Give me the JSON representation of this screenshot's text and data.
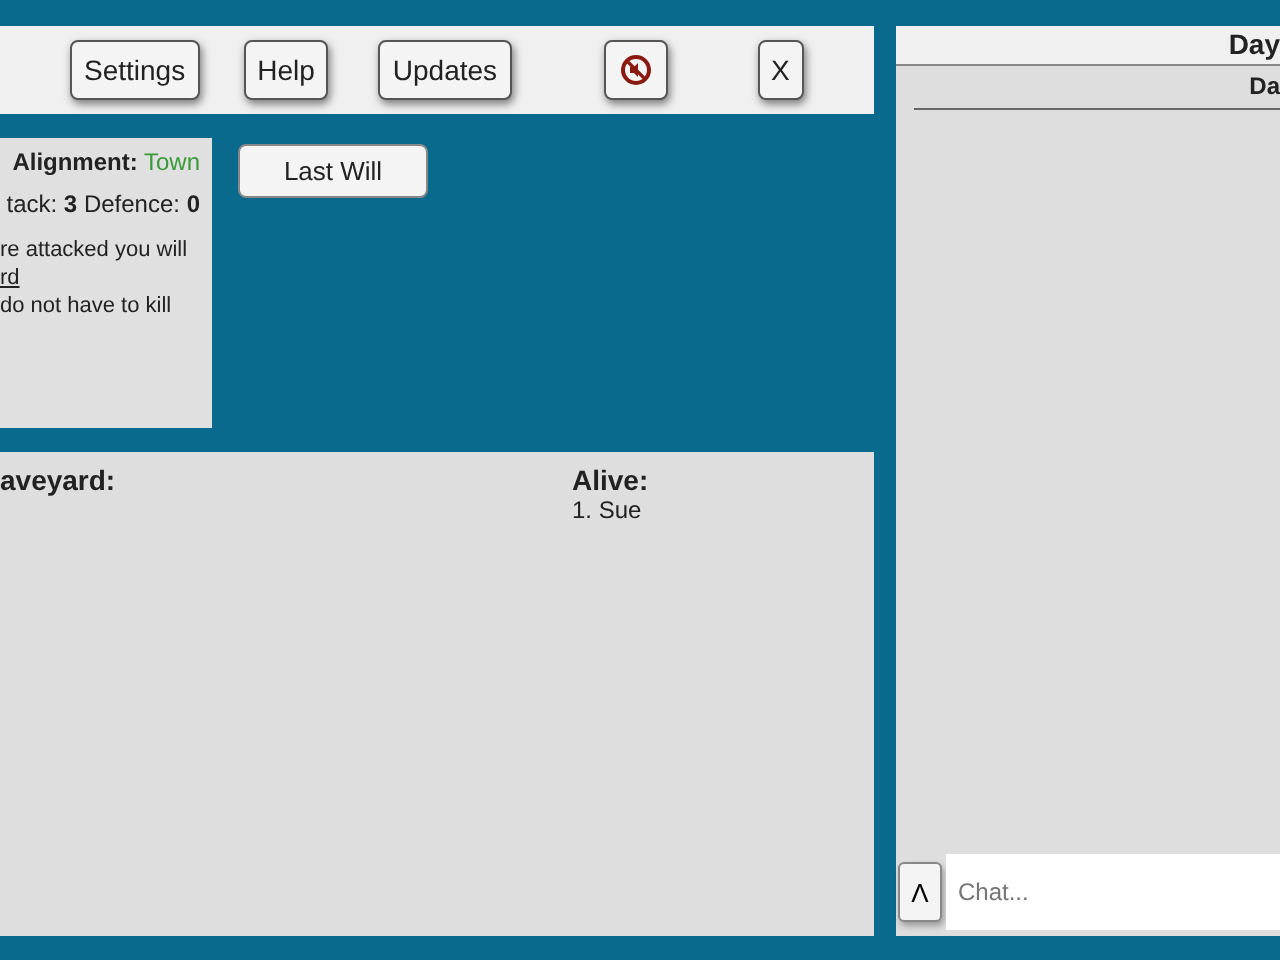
{
  "toolbar": {
    "buttons": [
      {
        "kind": "text",
        "label": "Settings"
      },
      {
        "kind": "text",
        "label": "Help"
      },
      {
        "kind": "text",
        "label": "Updates"
      },
      {
        "kind": "mute"
      },
      {
        "kind": "text",
        "label": "X"
      }
    ]
  },
  "role_card": {
    "alignment_label": "Alignment:",
    "alignment_value": "Town",
    "stats": "tack: **3**  Defence: **0**",
    "lines": [
      {
        "kind": "text",
        "text": "re attacked you will"
      },
      {
        "kind": "link",
        "text": "rd"
      },
      {
        "kind": "text",
        "text": "do not have to kill"
      }
    ]
  },
  "last_will_button": "Last Will",
  "graveyard": {
    "title": "aveyard:"
  },
  "alive": {
    "title": "Alive:",
    "players": [
      "1. Sue"
    ]
  },
  "chat_panel": {
    "title": "Day",
    "column_header": "Da",
    "toggle": "Λ",
    "placeholder": "Chat..."
  }
}
